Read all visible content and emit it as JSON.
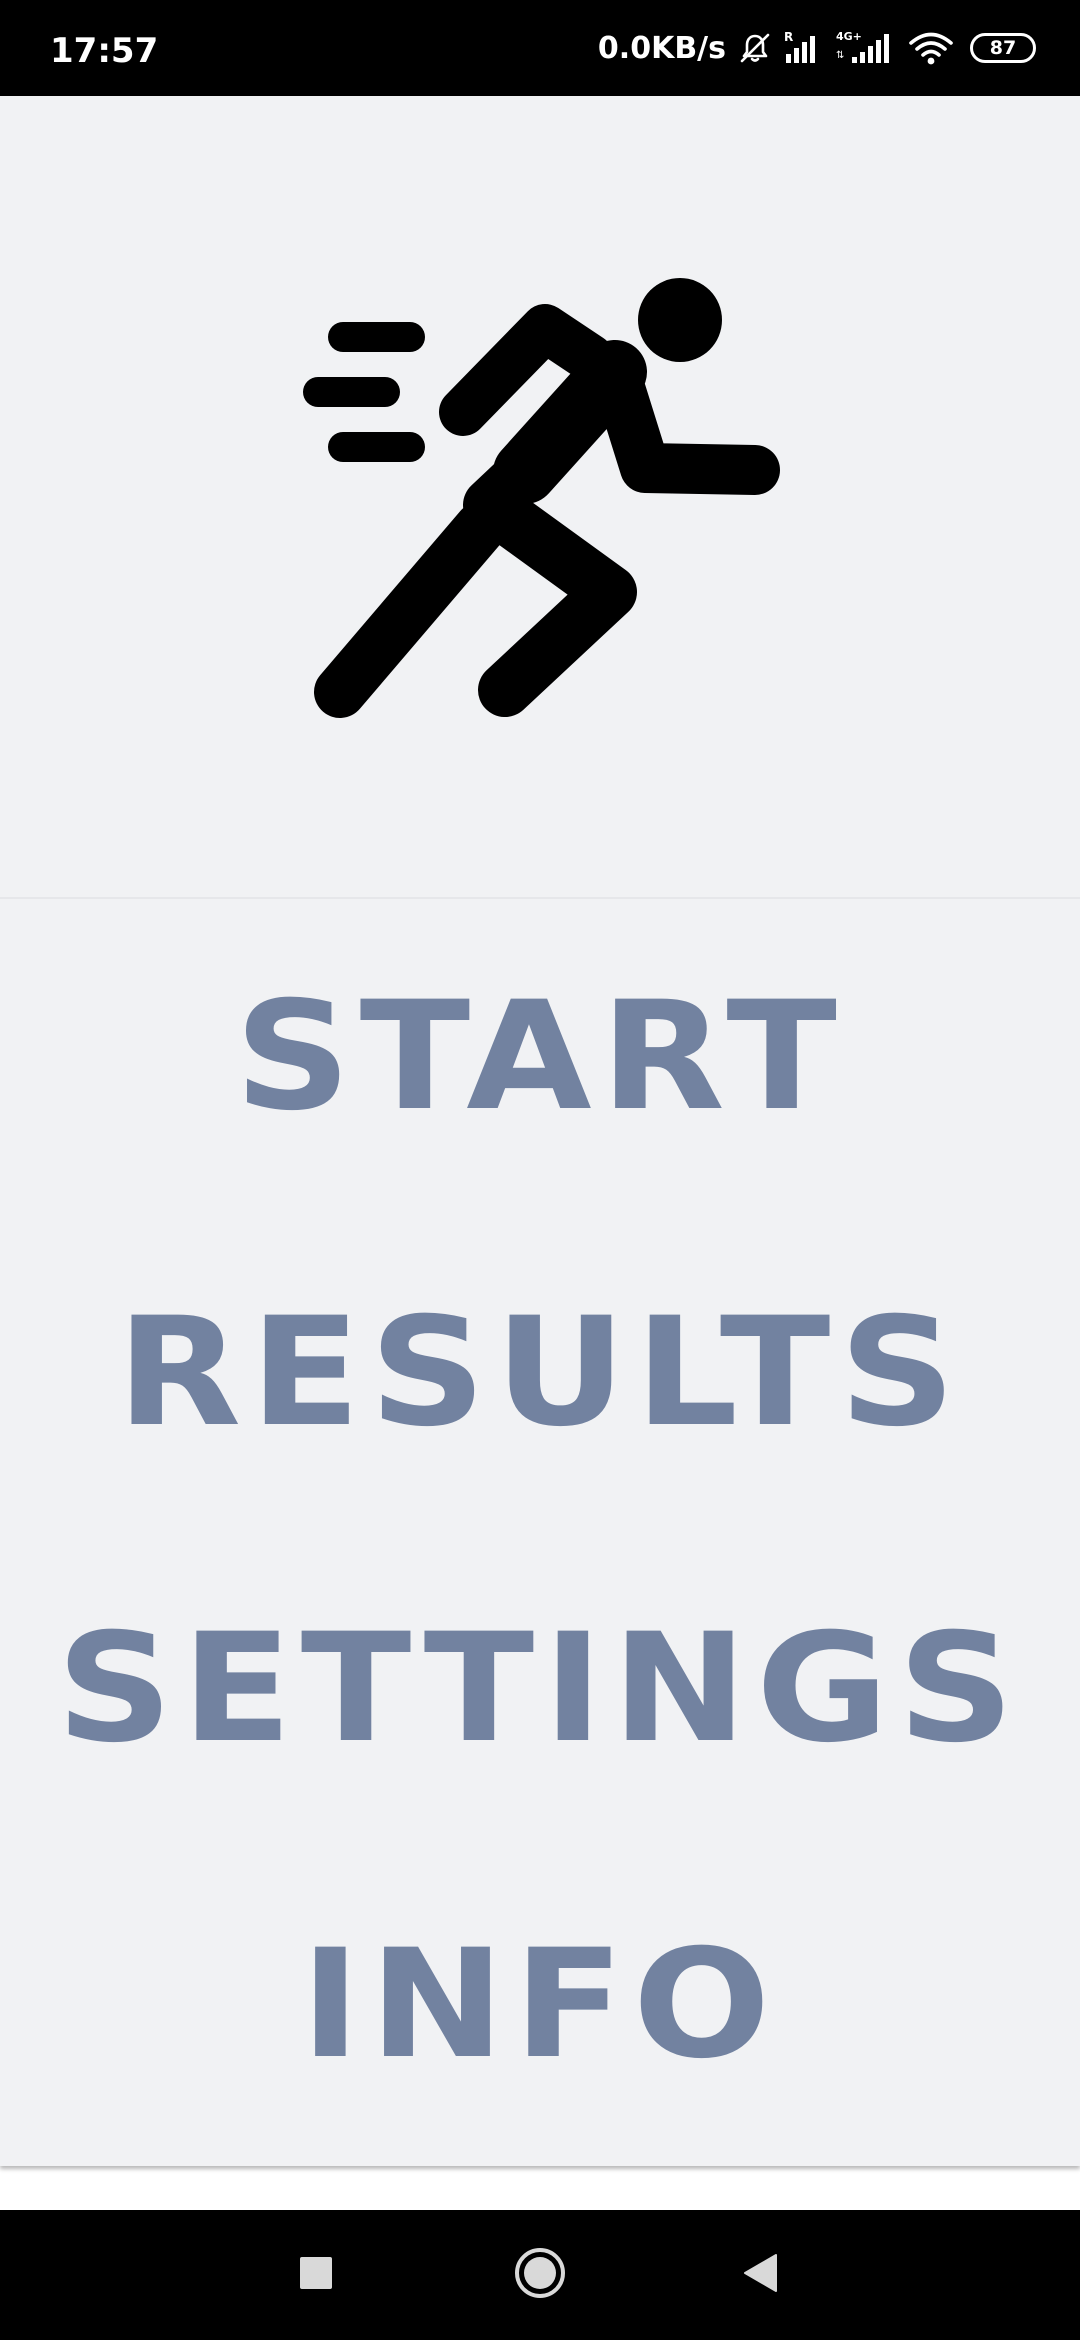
{
  "status_bar": {
    "time": "17:57",
    "network_speed": "0.0KB/s",
    "battery_level": "87",
    "icons": [
      "muted-bell-icon",
      "signal-roaming-icon",
      "signal-4g-icon",
      "wifi-icon",
      "battery-icon"
    ]
  },
  "hero": {
    "icon": "running-person-icon",
    "icon_color": "#000000"
  },
  "menu": {
    "label_color": "#7282a0",
    "items": [
      {
        "label": "START"
      },
      {
        "label": "RESULTS"
      },
      {
        "label": "SETTINGS"
      },
      {
        "label": "INFO"
      }
    ]
  },
  "nav_bar": {
    "buttons": [
      "recents-square-icon",
      "home-circle-icon",
      "back-triangle-icon"
    ]
  },
  "colors": {
    "background": "#f1f2f4",
    "system_bars": "#000000"
  }
}
